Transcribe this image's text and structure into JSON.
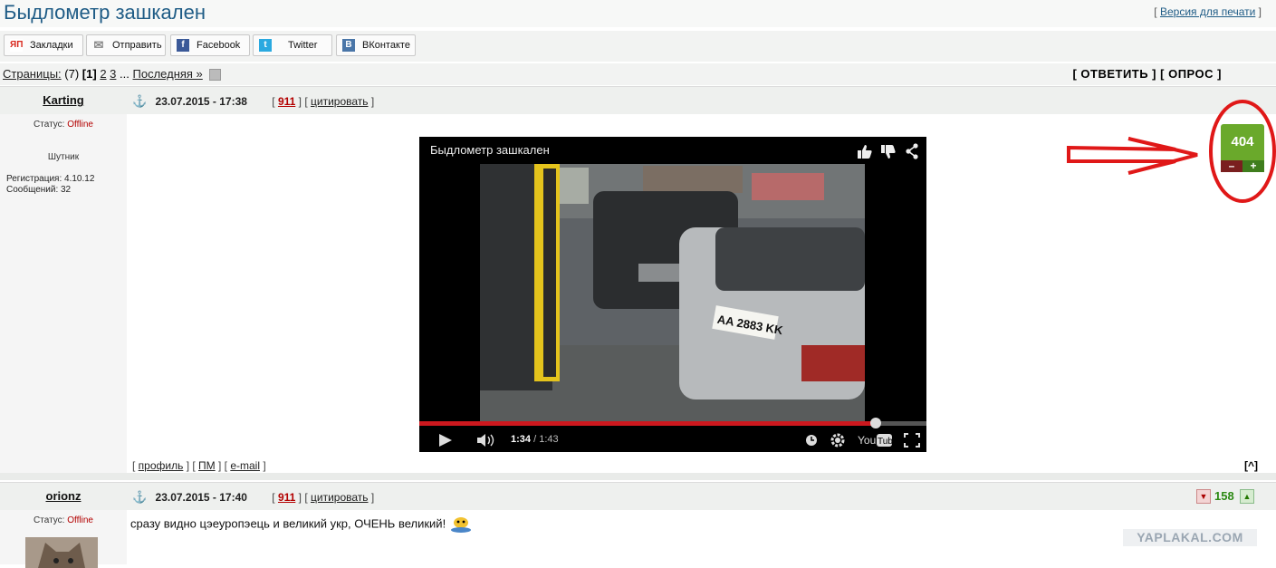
{
  "page": {
    "title": "Быдлометр зашкален",
    "print_link": "Версия для печати"
  },
  "share": [
    {
      "label": "Закладки",
      "icon": "yaplakal-icon",
      "color": "#d8261b",
      "glyph": "ЯП"
    },
    {
      "label": "Отправить",
      "icon": "envelope-icon",
      "color": "#888888",
      "glyph": "✉"
    },
    {
      "label": "Facebook",
      "icon": "facebook-icon",
      "color": "#3b5998",
      "glyph": "f"
    },
    {
      "label": "Twitter",
      "icon": "twitter-icon",
      "color": "#2aa9e0",
      "glyph": "t"
    },
    {
      "label": "ВКонтакте",
      "icon": "vk-icon",
      "color": "#4a76a8",
      "glyph": "B"
    }
  ],
  "pagination": {
    "label": "Страницы:",
    "count": "(7)",
    "current": "[1]",
    "pages": [
      "2",
      "3"
    ],
    "ellipsis": "...",
    "last": "Последняя »",
    "reply": "[ ОТВЕТИТЬ ]",
    "poll": "[ ОПРОС ]"
  },
  "posts": [
    {
      "user": "Karting",
      "date": "23.07.2015 - 17:38",
      "number": "911",
      "cite": "цитировать",
      "status_label": "Статус:",
      "status": "Offline",
      "rank": "Шутник",
      "registration": "Регистрация: 4.10.12",
      "messages": "Сообщений: 32",
      "rating": "404",
      "rating_minus": "–",
      "rating_plus": "+",
      "video": {
        "title": "Быдлометр зашкален",
        "current": "1:34",
        "total": "/ 1:43",
        "progress": 0.9,
        "plate": "AA 2883 KK"
      },
      "links": {
        "profile": "профиль",
        "pm": "ПМ",
        "email": "e-mail",
        "top": "[^]"
      }
    },
    {
      "user": "orionz",
      "date": "23.07.2015 - 17:40",
      "number": "911",
      "cite": "цитировать",
      "status_label": "Статус:",
      "status": "Offline",
      "rating": "158",
      "text": "сразу видно цэеуропэець и великий укр, ОЧЕНЬ великий!"
    }
  ],
  "watermark": "YAPLAKAL.COM",
  "colors": {
    "title": "#1f5c86",
    "offline": "#b30000",
    "rating_green": "#6aa92b",
    "annotation_red": "#e01818"
  }
}
